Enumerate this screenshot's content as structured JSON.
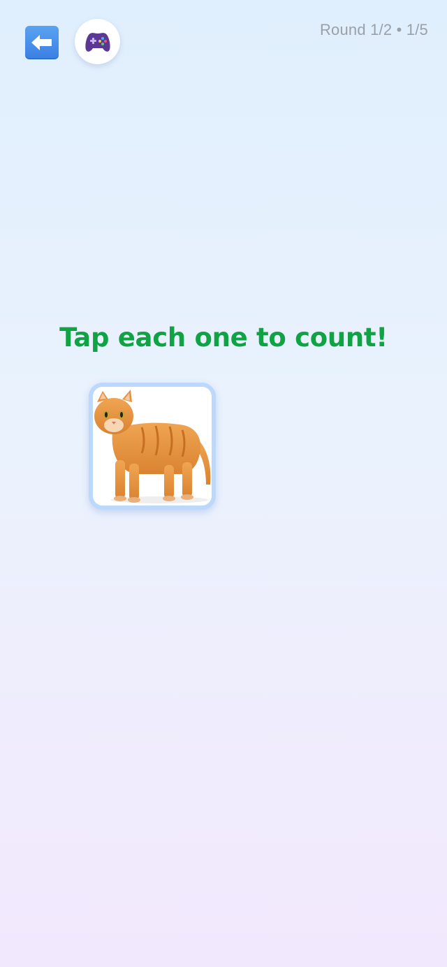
{
  "header": {
    "back_icon": "left-arrow-icon",
    "game_icon": "game-controller-icon",
    "round_status": "Round 1/2 • 1/5"
  },
  "main": {
    "prompt": "Tap each one to count!",
    "items": [
      {
        "icon": "cat-image",
        "label": "cat"
      }
    ]
  },
  "colors": {
    "prompt": "#0fa344",
    "back_button": "#3a7fe3",
    "card_border": "#bcd8fb"
  }
}
